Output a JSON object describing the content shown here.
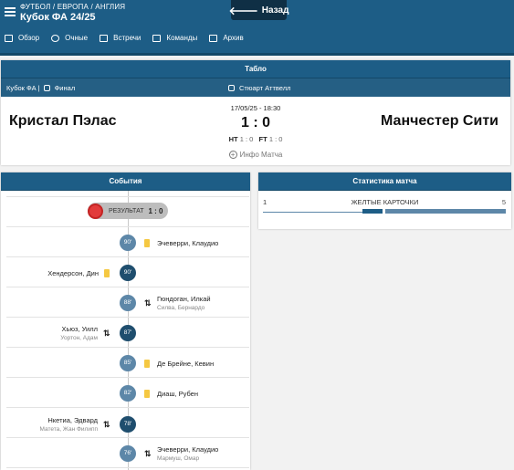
{
  "header": {
    "breadcrumb": "ФУТБОЛ / ЕВРОПА / АНГЛИЯ",
    "competition": "Кубок ФА 24/25",
    "back_label": "Назад",
    "nav": [
      {
        "label": "Обзор",
        "icon": "grid-icon"
      },
      {
        "label": "Очные",
        "icon": "users-icon"
      },
      {
        "label": "Встречи",
        "icon": "calendar-icon"
      },
      {
        "label": "Команды",
        "icon": "shirt-icon"
      },
      {
        "label": "Архив",
        "icon": "folder-icon"
      }
    ]
  },
  "scoreboard": {
    "title": "Табло",
    "tournament": "Кубок ФА |",
    "stage": "Финал",
    "referee": "Стюарт Аттвелл",
    "home": "Кристал Пэлас",
    "away": "Манчестер Сити",
    "datetime": "17/05/25 - 18:30",
    "score": "1 : 0",
    "ht_label": "HT",
    "ht_score": "1 : 0",
    "ft_label": "FT",
    "ft_score": "1 : 0",
    "info_label": "Инфо Матча"
  },
  "events": {
    "title": "События",
    "result_label": "РЕЗУЛЬТАТ",
    "result_score": "1 : 0",
    "items": [
      {
        "minute": "90'",
        "side": "away",
        "type": "yellow",
        "player": "Эчеверри, Клаудио",
        "sub": ""
      },
      {
        "minute": "90'",
        "side": "home",
        "type": "yellow",
        "player": "Хендерсон, Дин",
        "sub": ""
      },
      {
        "minute": "88'",
        "side": "away",
        "type": "sub",
        "player": "Гюндоган, Илкай",
        "sub": "Силва, Бернардо"
      },
      {
        "minute": "87'",
        "side": "home",
        "type": "sub",
        "player": "Хьюз, Уилл",
        "sub": "Уортон, Адам"
      },
      {
        "minute": "85'",
        "side": "away",
        "type": "yellow",
        "player": "Де Брейне, Кевин",
        "sub": ""
      },
      {
        "minute": "82'",
        "side": "away",
        "type": "yellow",
        "player": "Диаш, Рубен",
        "sub": ""
      },
      {
        "minute": "78'",
        "side": "home",
        "type": "sub",
        "player": "Нкетиа, Эдвард",
        "sub": "Матета, Жан Филипп"
      },
      {
        "minute": "76'",
        "side": "away",
        "type": "sub",
        "player": "Эчеверри, Клаудио",
        "sub": "Мармуш, Омар"
      }
    ]
  },
  "stats": {
    "title": "Статистика матча",
    "rows": [
      {
        "label": "ЖЕЛТЫЕ КАРТОЧКИ",
        "home": "1",
        "away": "5",
        "home_share": 0.17,
        "away_share": 0.83
      }
    ]
  },
  "colors": {
    "primary": "#1d5d86",
    "dark": "#0f2f45",
    "home_minute": "#5d87a8",
    "away_minute": "#1f4e6e",
    "yellow_card": "#f5c842",
    "result_dot": "#e23b3b"
  }
}
